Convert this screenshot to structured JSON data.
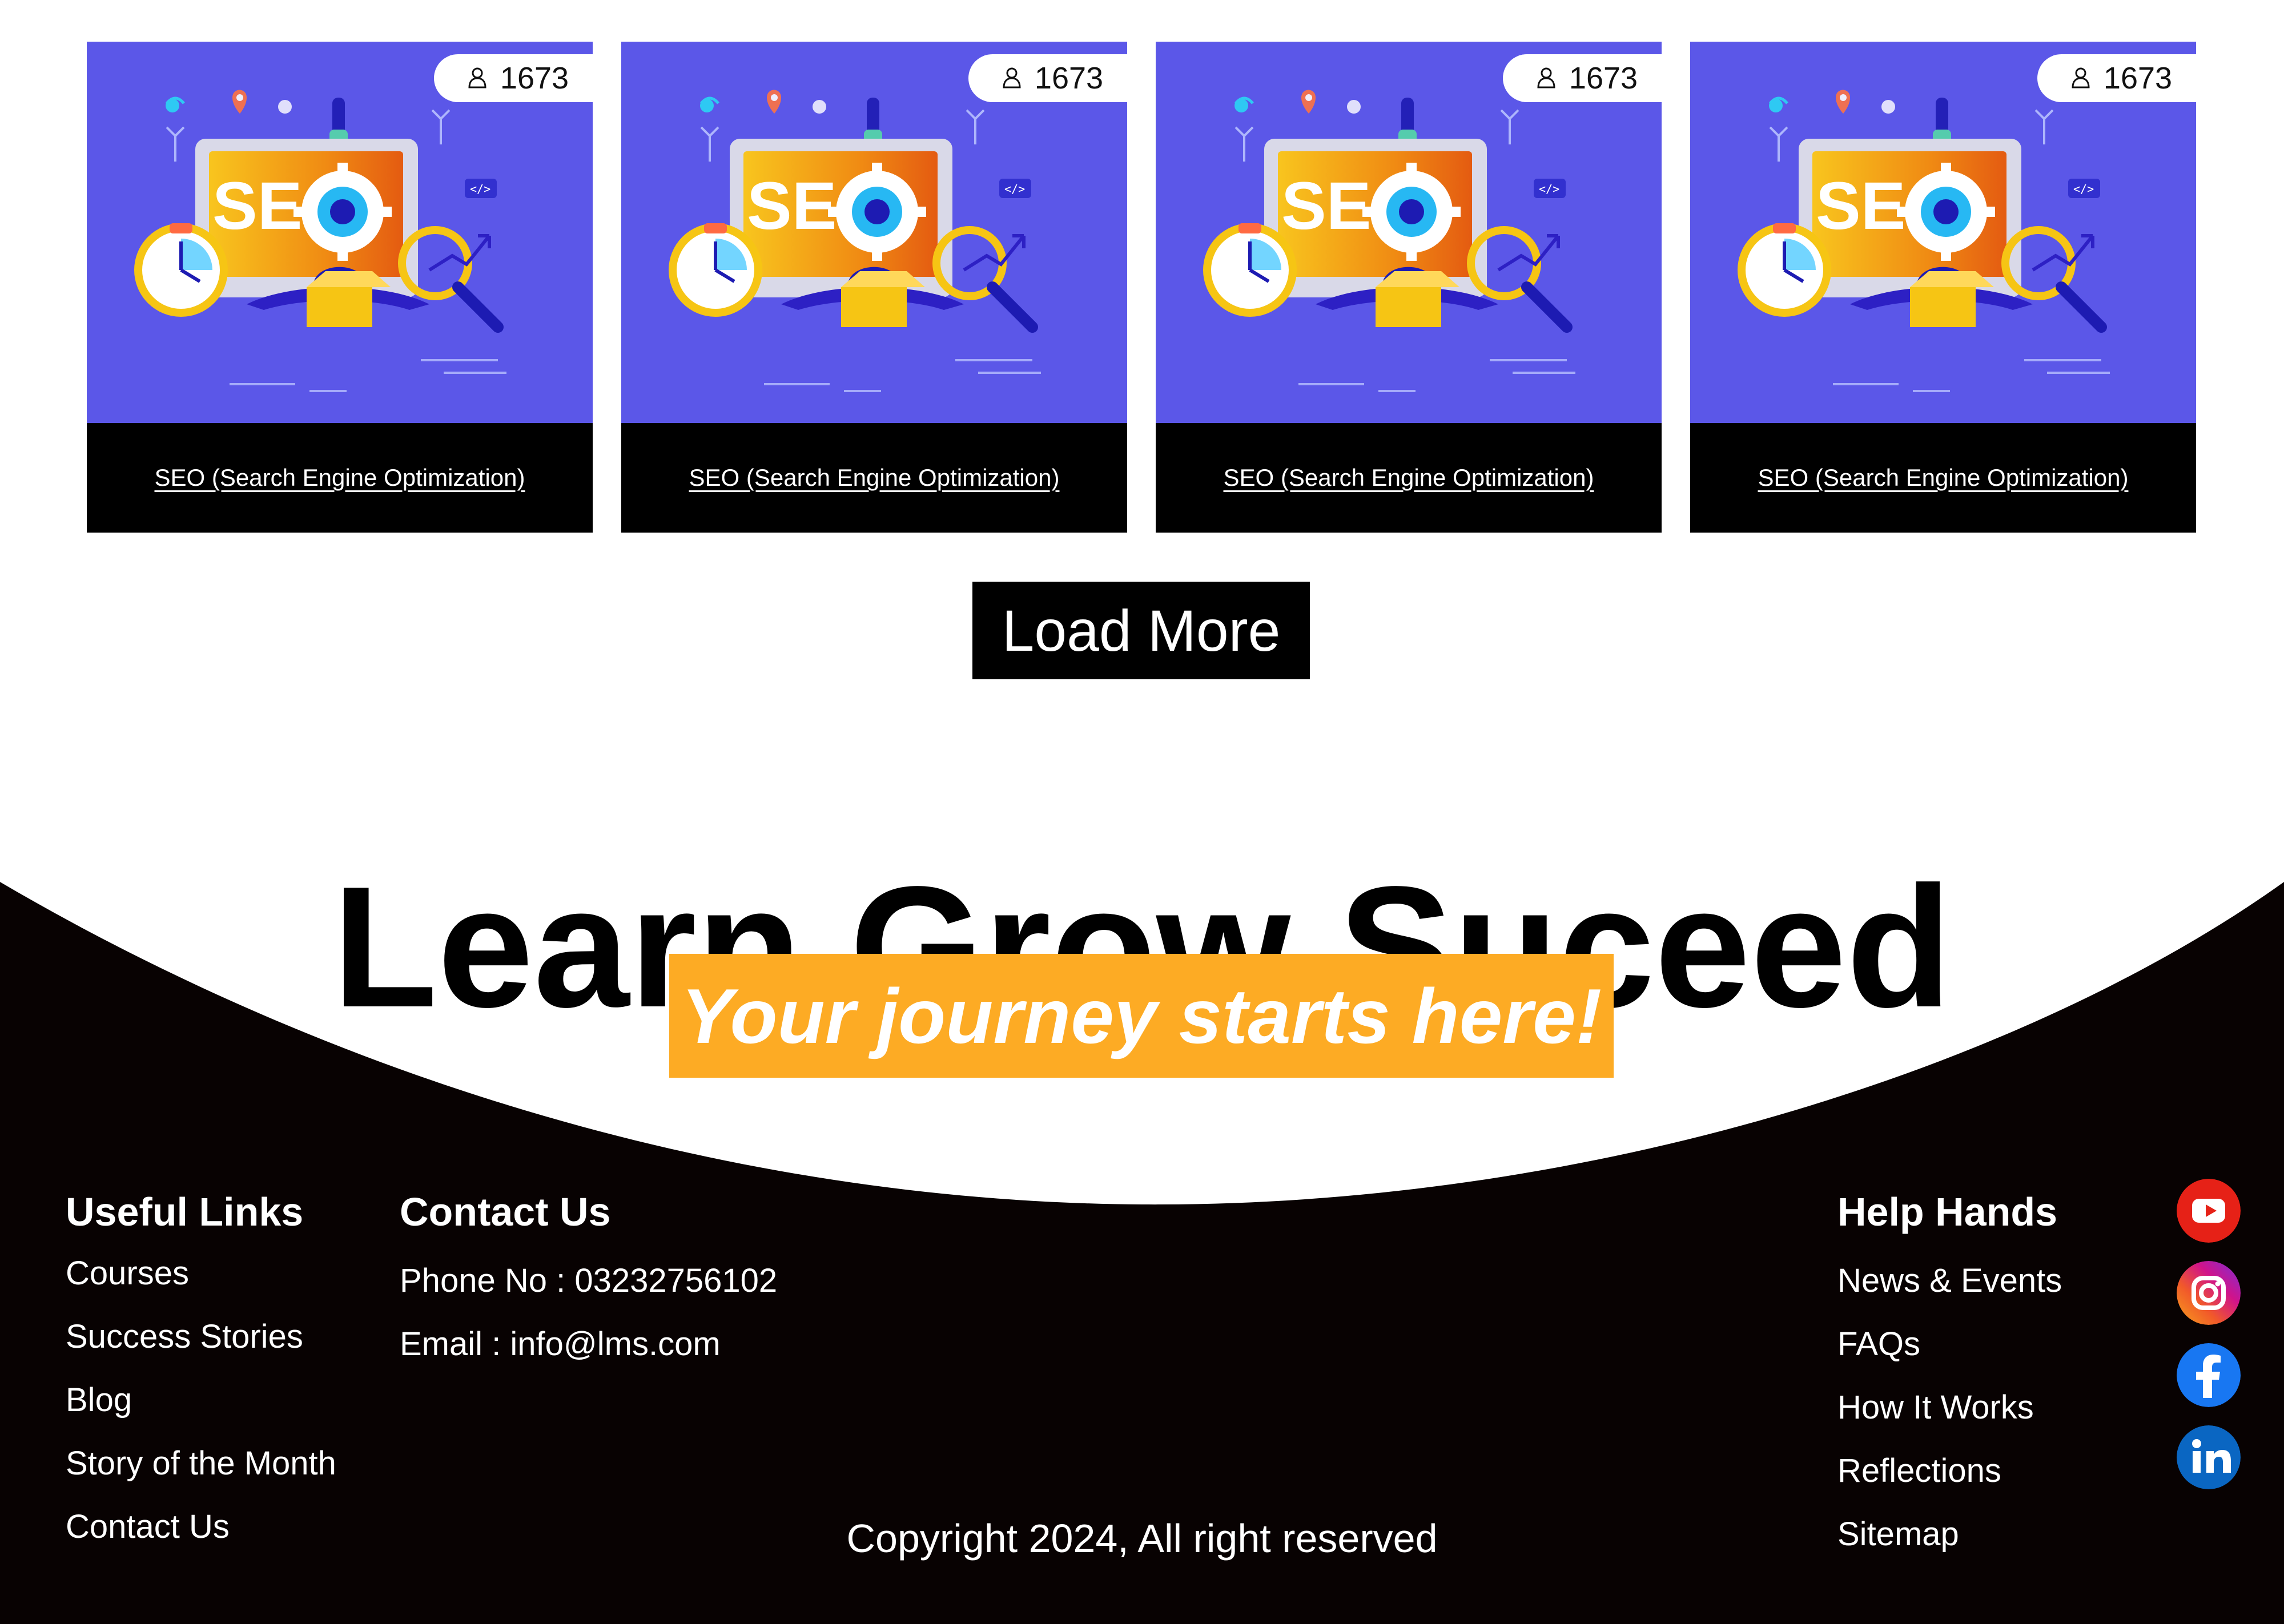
{
  "courses": [
    {
      "title": "SEO (Search Engine Optimization)",
      "learners": "1673",
      "image_label": "SEO"
    },
    {
      "title": "SEO (Search Engine Optimization)",
      "learners": "1673",
      "image_label": "SEO"
    },
    {
      "title": "SEO (Search Engine Optimization)",
      "learners": "1673",
      "image_label": "SEO"
    },
    {
      "title": "SEO (Search Engine Optimization)",
      "learners": "1673",
      "image_label": "SEO"
    }
  ],
  "load_more": {
    "label": "Load More"
  },
  "hero": {
    "title": "Learn Grow Suceed",
    "tagline": "Your journey starts here!"
  },
  "footer": {
    "useful_links": {
      "heading": "Useful Links",
      "items": [
        "Courses",
        "Success Stories",
        "Blog",
        "Story of the Month",
        "Contact Us"
      ]
    },
    "contact_us": {
      "heading": "Contact Us",
      "phone": "Phone No : 03232756102",
      "email": "Email : info@lms.com"
    },
    "help_hands": {
      "heading": "Help Hands",
      "items": [
        "News & Events",
        "FAQs",
        "How It Works",
        "Reflections",
        "Sitemap"
      ]
    },
    "copyright": "Copyright 2024, All right reserved"
  },
  "social": [
    {
      "name": "youtube",
      "icon": "youtube-icon"
    },
    {
      "name": "instagram",
      "icon": "instagram-icon"
    },
    {
      "name": "facebook",
      "icon": "facebook-icon"
    },
    {
      "name": "linkedin",
      "icon": "linkedin-icon"
    }
  ],
  "colors": {
    "footer_bg": "#080202",
    "tagline_bg": "#fdab24",
    "card_bg": "#5b58e7",
    "card_caption_bg": "#000000",
    "load_more_bg": "#000000"
  }
}
